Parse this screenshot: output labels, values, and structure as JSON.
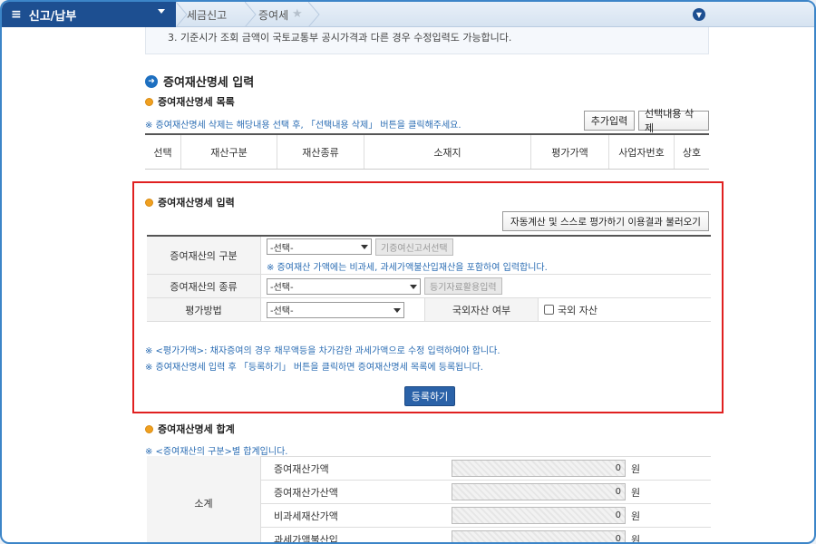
{
  "topbar": {
    "menu_label": "신고/납부",
    "breadcrumb": [
      "세금신고",
      "증여세"
    ]
  },
  "notice_text": "3. 기준시가 조회 금액이 국토교통부 공시가격과 다른 경우 수정입력도 가능합니다.",
  "section": {
    "title": "증여재산명세 입력",
    "list_title": "증여재산명세 목록",
    "list_info": "※ 증여재산명세 삭제는 해당내용 선택 후, 「선택내용 삭제」 버튼을 클릭해주세요.",
    "add_button": "추가입력",
    "delete_button": "선택내용 삭제",
    "columns": [
      "선택",
      "재산구분",
      "재산종류",
      "소재지",
      "평가가액",
      "사업자번호",
      "상호"
    ]
  },
  "input_box": {
    "title": "증여재산명세 입력",
    "auto_calc_button": "자동계산 및 스스로 평가하기 이용결과 불러오기",
    "rows": {
      "category_label": "증여재산의 구분",
      "category_value": "-선택-",
      "category_button": "기증여신고서선택",
      "category_note": "※ 증여재산 가액에는 비과세, 과세가액불산입재산을 포함하여 입력합니다.",
      "type_label": "증여재산의 종류",
      "type_value": "-선택-",
      "type_button": "등기자료활용입력",
      "method_label": "평가방법",
      "method_value": "-선택-",
      "foreign_label": "국외자산 여부",
      "foreign_checkbox": "국외 자산"
    },
    "note1": "※ <평가가액>: 채자증여의 경우 채무액등을 차가감한 과세가액으로 수정 입력하여야 합니다.",
    "note2": "※ 증여재산명세 입력 후 「등록하기」 버튼을 클릭하면 증여재산명세 목록에 등록됩니다.",
    "register_button": "등록하기"
  },
  "summary": {
    "title": "증여재산명세 합계",
    "info": "※ <증여재산의 구분>별 합계입니다.",
    "group_label": "소계",
    "unit": "원",
    "rows": [
      {
        "name": "증여재산가액",
        "value": "0"
      },
      {
        "name": "증여재산가산액",
        "value": "0"
      },
      {
        "name": "비과세재산가액",
        "value": "0"
      },
      {
        "name": "과세가액불산입",
        "value": "0"
      }
    ]
  },
  "colors": {
    "nav_blue": "#1d4f91",
    "highlight_red": "#e02020",
    "button_blue": "#2a62a8"
  }
}
